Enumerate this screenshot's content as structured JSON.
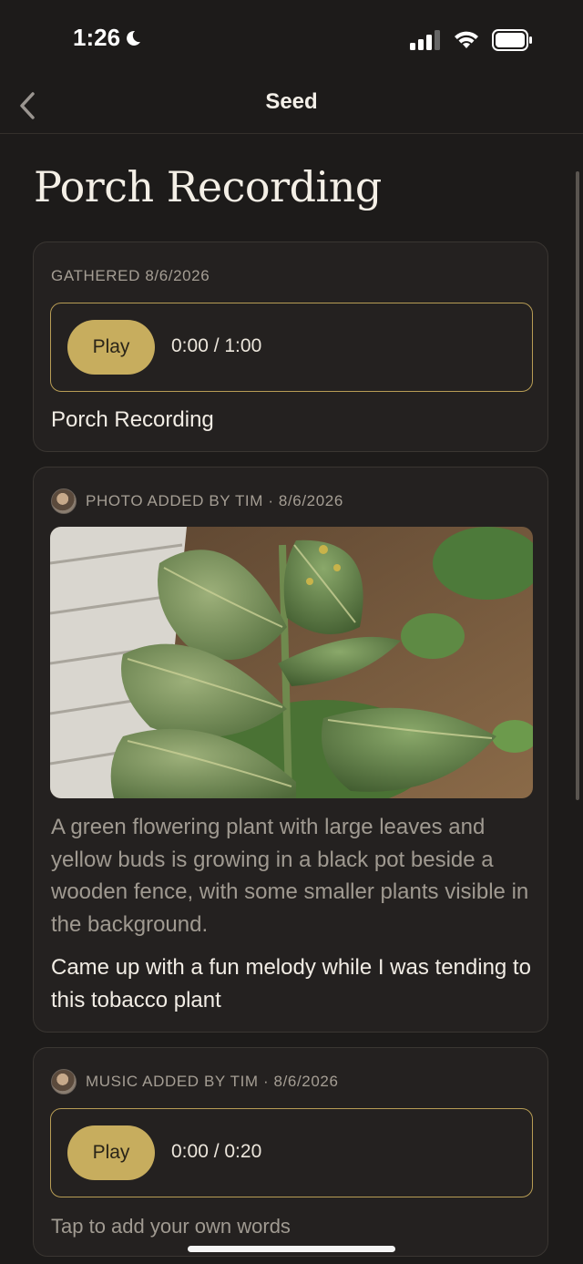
{
  "status_bar": {
    "time": "1:26"
  },
  "nav": {
    "title": "Seed"
  },
  "page": {
    "title": "Porch Recording"
  },
  "recording_card": {
    "meta": "GATHERED 8/6/2026",
    "player": {
      "play_label": "Play",
      "time": "0:00 / 1:00"
    },
    "title": "Porch Recording"
  },
  "photo_card": {
    "meta": "PHOTO ADDED BY TIM · 8/6/2026",
    "caption": "A green flowering plant with large leaves and yellow buds is growing in a black pot beside a wooden fence, with some smaller plants visible in the background.",
    "note": "Came up with a fun melody while I was tending to this tobacco plant"
  },
  "music_card": {
    "meta": "MUSIC ADDED BY TIM · 8/6/2026",
    "player": {
      "play_label": "Play",
      "time": "0:00 / 0:20"
    },
    "placeholder": "Tap to add your own words"
  },
  "colors": {
    "accent": "#c7ad5e",
    "background": "#1d1b1a",
    "card": "#242120",
    "border_accent": "#b89d55"
  }
}
